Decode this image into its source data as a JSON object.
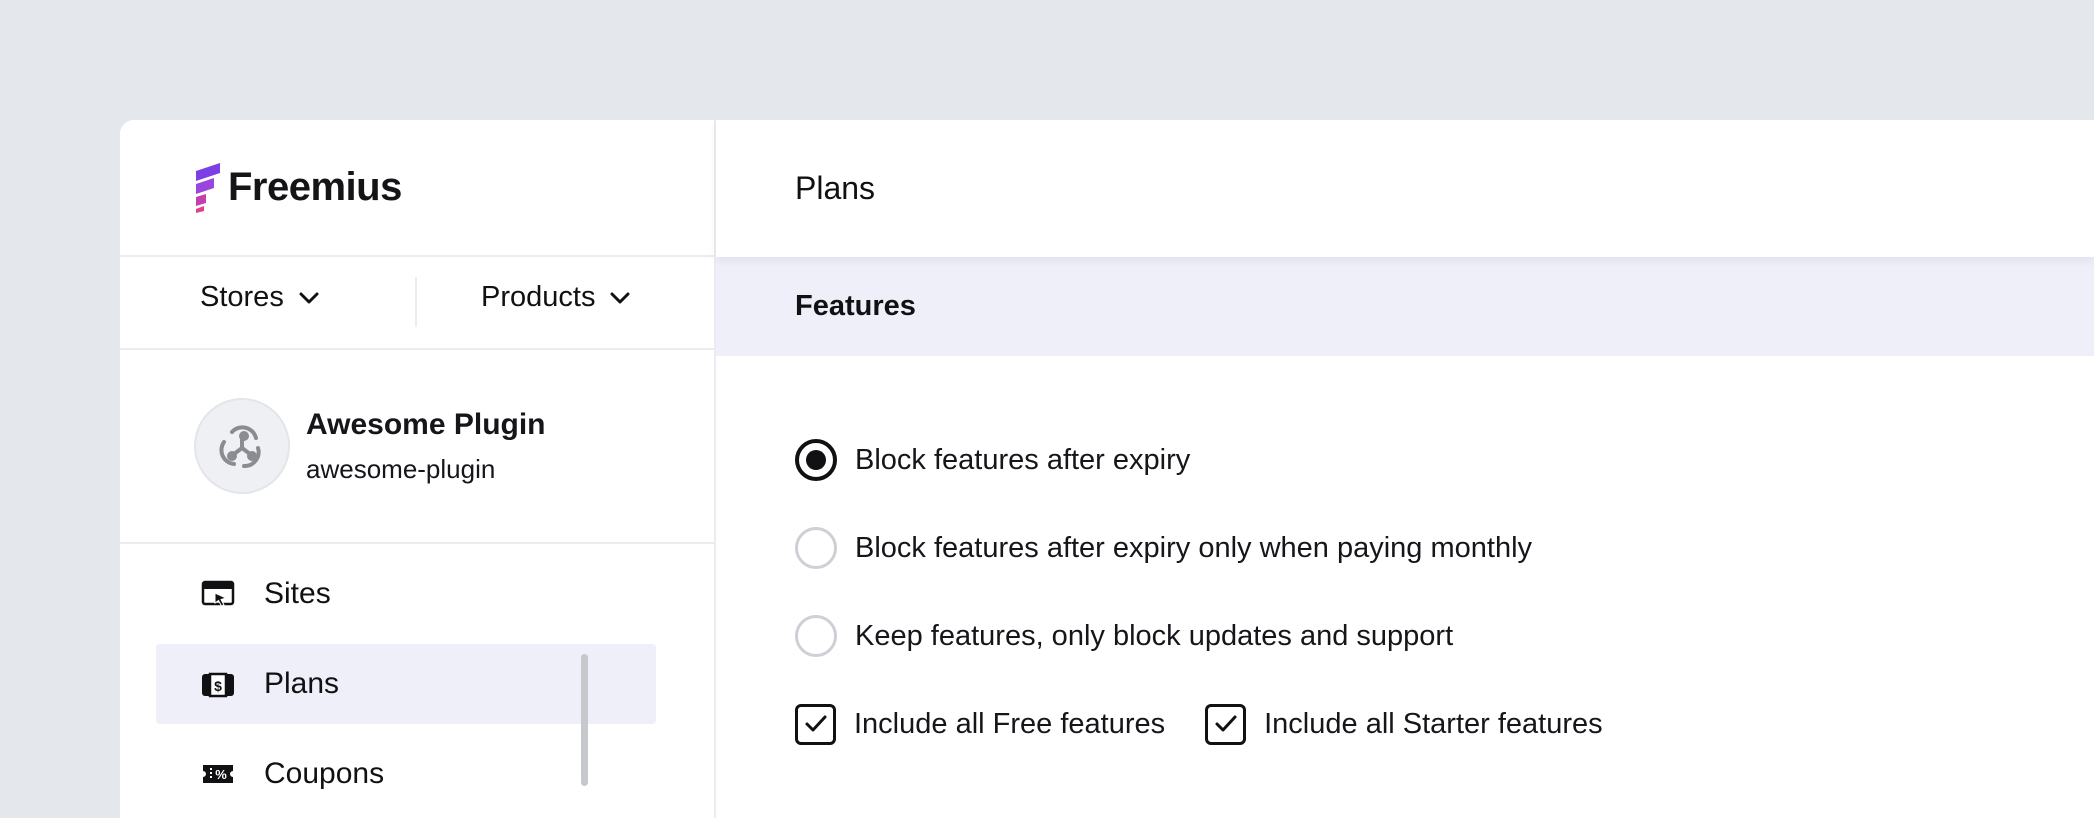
{
  "brand": {
    "name": "Freemius",
    "logo_icon": "freemius-logo-icon",
    "colors": {
      "logo_purple": "#7b3fe4",
      "logo_pink": "#e23e8c"
    }
  },
  "switcher": {
    "stores_label": "Stores",
    "products_label": "Products"
  },
  "product": {
    "name": "Awesome Plugin",
    "slug": "awesome-plugin",
    "avatar_icon": "plugin-logo-icon"
  },
  "nav": {
    "items": [
      {
        "label": "Sites",
        "icon": "sites-icon",
        "active": false
      },
      {
        "label": "Plans",
        "icon": "plans-icon",
        "active": true
      },
      {
        "label": "Coupons",
        "icon": "coupons-icon",
        "active": false
      }
    ]
  },
  "main": {
    "title": "Plans",
    "section_title": "Features",
    "radio_options": [
      {
        "label": "Block features after expiry",
        "checked": true
      },
      {
        "label": "Block features after expiry only when paying monthly",
        "checked": false
      },
      {
        "label": "Keep features, only block updates and support",
        "checked": false
      }
    ],
    "checkboxes": [
      {
        "label": "Include all Free features",
        "checked": true
      },
      {
        "label": "Include all Starter features",
        "checked": true
      }
    ]
  },
  "colors": {
    "background": "#e4e7ec",
    "panel": "#ffffff",
    "active_nav": "#eeeff8",
    "section_band": "#eeeff8",
    "text": "#111114"
  }
}
